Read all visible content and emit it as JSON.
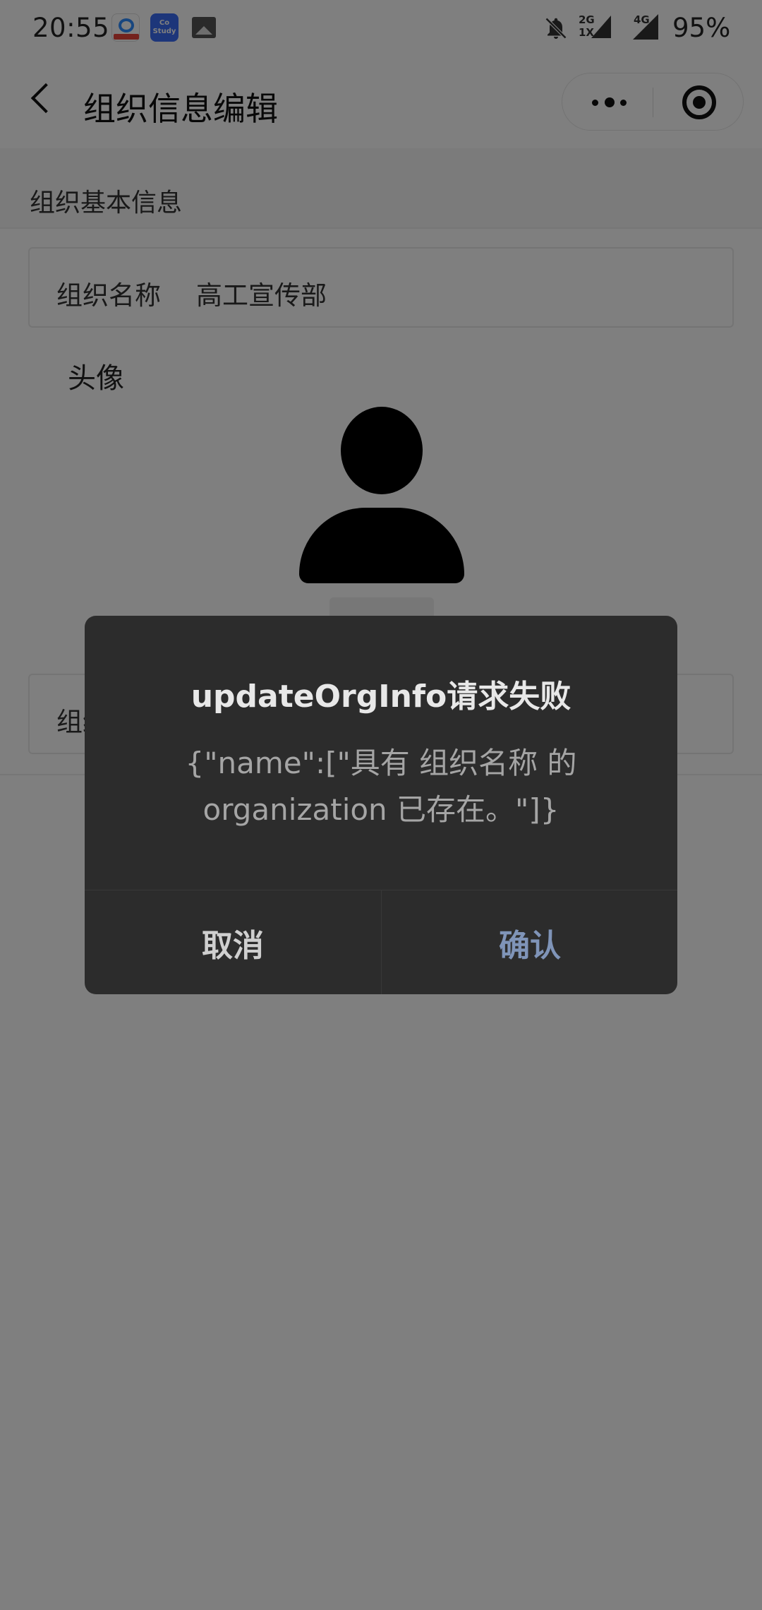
{
  "status_bar": {
    "time": "20:55",
    "net_top": "2G",
    "net_bottom": "1X",
    "net_4g": "4G",
    "battery": "95%",
    "icons": [
      "baidu-netdisk-icon",
      "costudy-app-icon",
      "gallery-icon",
      "bell-off-icon",
      "signal-icon"
    ],
    "costudy_label": "Co Study"
  },
  "nav": {
    "title": "组织信息编辑",
    "icons": [
      "back-icon",
      "more-icon",
      "close-miniprogram-icon"
    ]
  },
  "form": {
    "section_title": "组织基本信息",
    "name_label": "组织名称",
    "name_value": "高工宣传部",
    "avatar_label": "头像",
    "second_field_label": "组织"
  },
  "dialog": {
    "title": "updateOrgInfo请求失败",
    "message": "{\"name\":[\"具有 组织名称 的 organization 已存在。\"]}",
    "cancel_label": "取消",
    "confirm_label": "确认"
  },
  "colors": {
    "mask": "rgba(0,0,0,0.5)",
    "dialog_bg": "#2c2c2c",
    "confirm_text": "#7f94b8"
  }
}
